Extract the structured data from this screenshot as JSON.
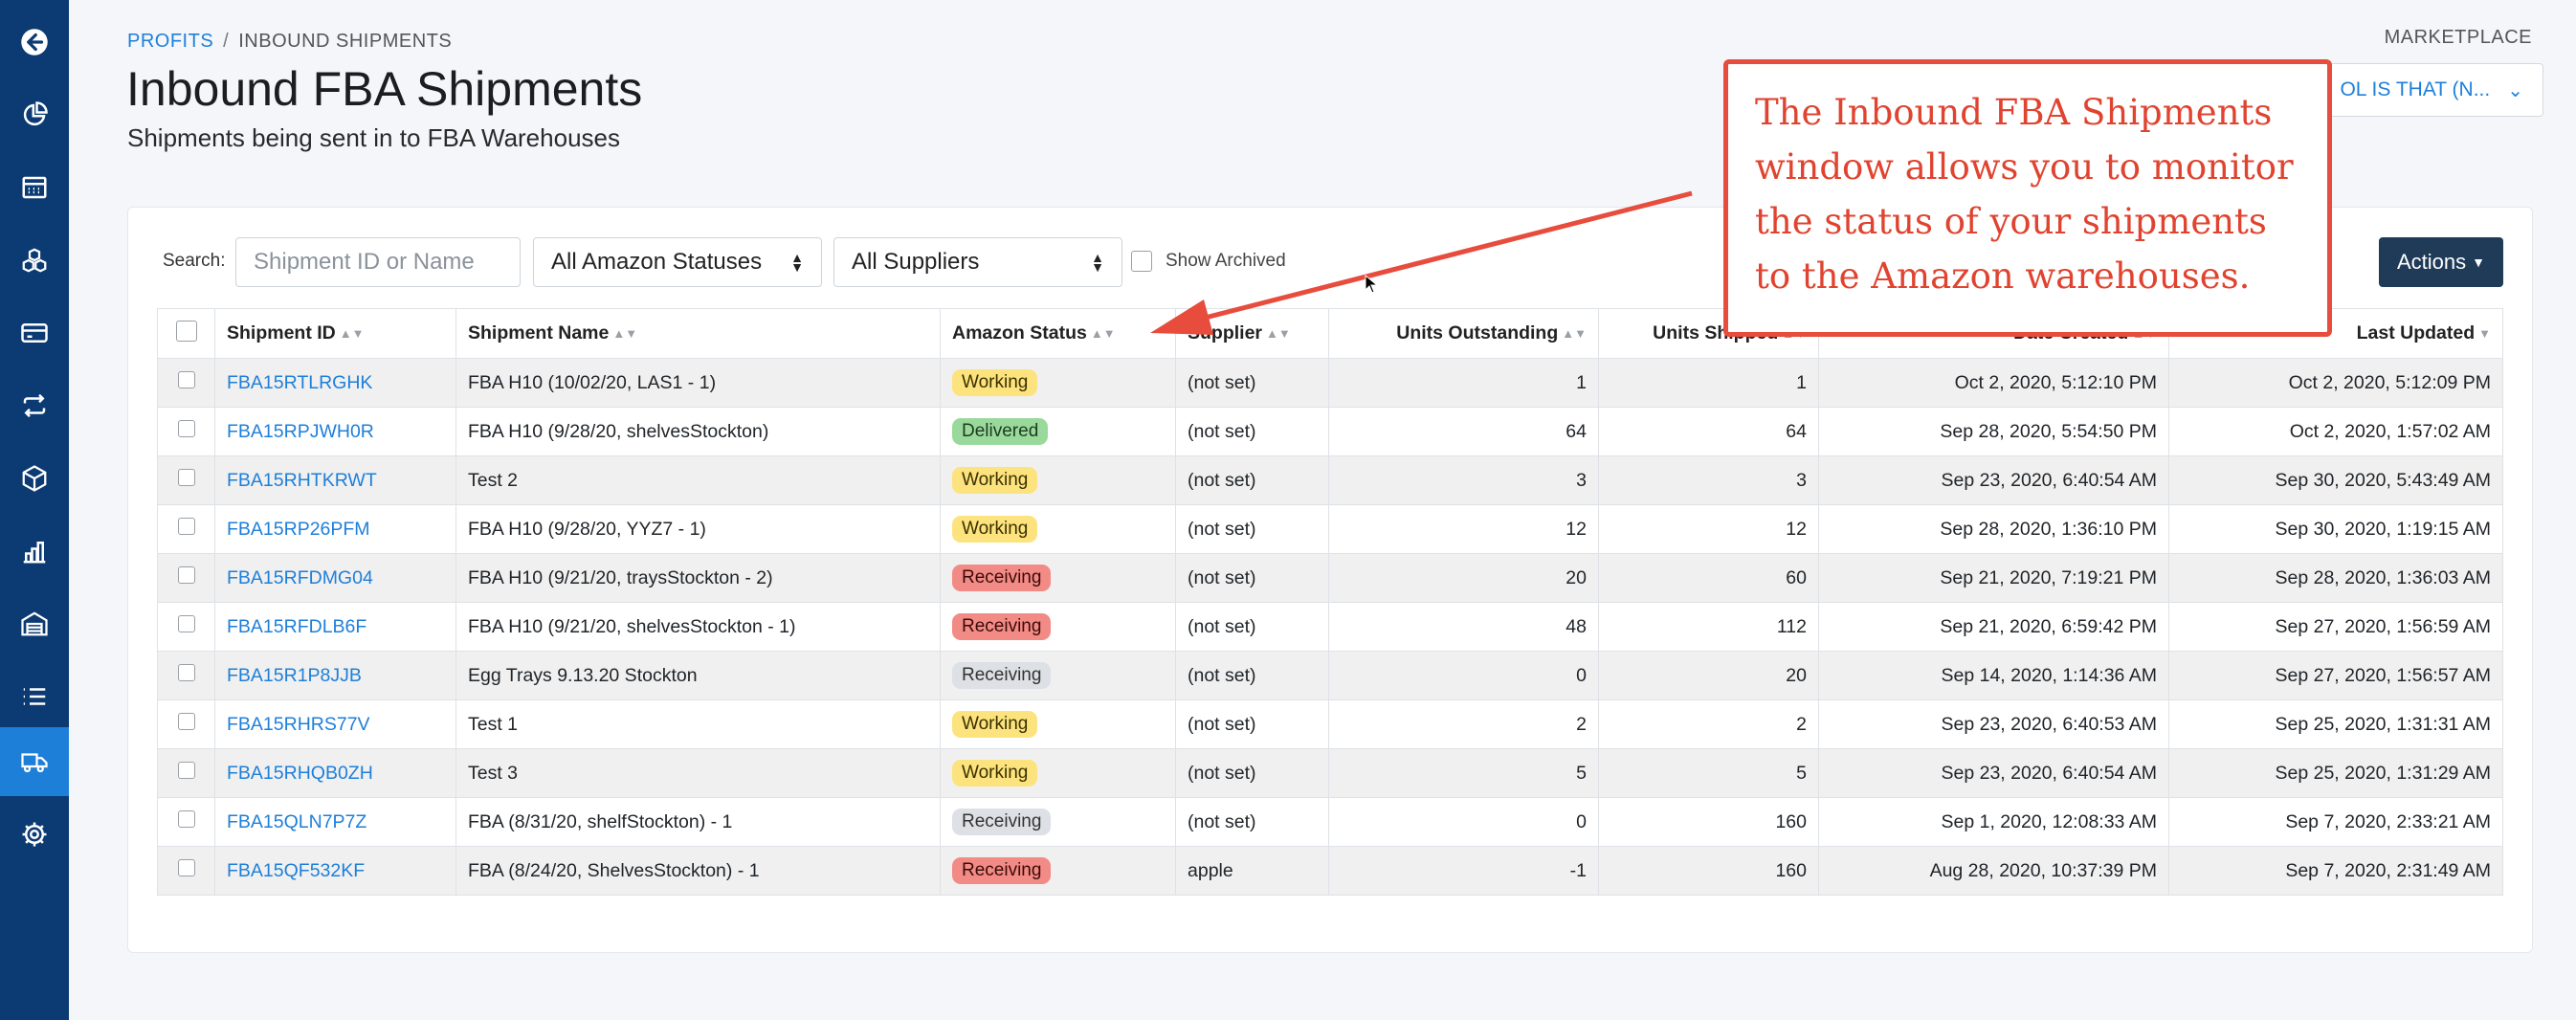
{
  "sidebar": {
    "items": [
      {
        "name": "back-icon"
      },
      {
        "name": "pie-chart-icon"
      },
      {
        "name": "calculator-icon"
      },
      {
        "name": "boxes-icon"
      },
      {
        "name": "credit-card-icon"
      },
      {
        "name": "repeat-icon"
      },
      {
        "name": "cube-icon"
      },
      {
        "name": "bar-chart-icon"
      },
      {
        "name": "warehouse-icon"
      },
      {
        "name": "list-icon"
      },
      {
        "name": "truck-icon"
      },
      {
        "name": "gear-icon"
      }
    ],
    "active": "truck-icon"
  },
  "breadcrumb": {
    "root": "PROFITS",
    "separator": "/",
    "current": "INBOUND SHIPMENTS"
  },
  "header": {
    "title": "Inbound FBA Shipments",
    "subtitle": "Shipments being sent in to FBA Warehouses",
    "marketplace_label": "MARKETPLACE",
    "marketplace_value": "OL IS THAT (N..."
  },
  "filters": {
    "search_label": "Search:",
    "search_placeholder": "Shipment ID or Name",
    "status_select": "All Amazon Statuses",
    "supplier_select": "All Suppliers",
    "archived_label": "Show Archived",
    "actions_label": "Actions"
  },
  "table": {
    "columns": [
      "Shipment ID",
      "Shipment Name",
      "Amazon Status",
      "Supplier",
      "Units Outstanding",
      "Units Shipped",
      "Date Created",
      "Last Updated"
    ],
    "rows": [
      {
        "id": "FBA15RTLRGHK",
        "name": "FBA H10 (10/02/20, LAS1 - 1)",
        "status": "Working",
        "supplier": "(not set)",
        "outstanding": "1",
        "shipped": "1",
        "created": "Oct 2, 2020, 5:12:10 PM",
        "updated": "Oct 2, 2020, 5:12:09 PM"
      },
      {
        "id": "FBA15RPJWH0R",
        "name": "FBA H10 (9/28/20, shelvesStockton)",
        "status": "Delivered",
        "supplier": "(not set)",
        "outstanding": "64",
        "shipped": "64",
        "created": "Sep 28, 2020, 5:54:50 PM",
        "updated": "Oct 2, 2020, 1:57:02 AM"
      },
      {
        "id": "FBA15RHTKRWT",
        "name": "Test 2",
        "status": "Working",
        "supplier": "(not set)",
        "outstanding": "3",
        "shipped": "3",
        "created": "Sep 23, 2020, 6:40:54 AM",
        "updated": "Sep 30, 2020, 5:43:49 AM"
      },
      {
        "id": "FBA15RP26PFM",
        "name": "FBA H10 (9/28/20, YYZ7 - 1)",
        "status": "Working",
        "supplier": "(not set)",
        "outstanding": "12",
        "shipped": "12",
        "created": "Sep 28, 2020, 1:36:10 PM",
        "updated": "Sep 30, 2020, 1:19:15 AM"
      },
      {
        "id": "FBA15RFDMG04",
        "name": "FBA H10 (9/21/20, traysStockton - 2)",
        "status": "Receiving",
        "supplier": "(not set)",
        "outstanding": "20",
        "shipped": "60",
        "created": "Sep 21, 2020, 7:19:21 PM",
        "updated": "Sep 28, 2020, 1:36:03 AM"
      },
      {
        "id": "FBA15RFDLB6F",
        "name": "FBA H10 (9/21/20, shelvesStockton - 1)",
        "status": "Receiving",
        "supplier": "(not set)",
        "outstanding": "48",
        "shipped": "112",
        "created": "Sep 21, 2020, 6:59:42 PM",
        "updated": "Sep 27, 2020, 1:56:59 AM"
      },
      {
        "id": "FBA15R1P8JJB",
        "name": "Egg Trays 9.13.20 Stockton",
        "status": "Receiving",
        "supplier": "(not set)",
        "outstanding": "0",
        "shipped": "20",
        "created": "Sep 14, 2020, 1:14:36 AM",
        "updated": "Sep 27, 2020, 1:56:57 AM"
      },
      {
        "id": "FBA15RHRS77V",
        "name": "Test 1",
        "status": "Working",
        "supplier": "(not set)",
        "outstanding": "2",
        "shipped": "2",
        "created": "Sep 23, 2020, 6:40:53 AM",
        "updated": "Sep 25, 2020, 1:31:31 AM"
      },
      {
        "id": "FBA15RHQB0ZH",
        "name": "Test 3",
        "status": "Working",
        "supplier": "(not set)",
        "outstanding": "5",
        "shipped": "5",
        "created": "Sep 23, 2020, 6:40:54 AM",
        "updated": "Sep 25, 2020, 1:31:29 AM"
      },
      {
        "id": "FBA15QLN7P7Z",
        "name": "FBA (8/31/20, shelfStockton) - 1",
        "status": "Receiving",
        "supplier": "(not set)",
        "outstanding": "0",
        "shipped": "160",
        "created": "Sep 1, 2020, 12:08:33 AM",
        "updated": "Sep 7, 2020, 2:33:21 AM"
      },
      {
        "id": "FBA15QF532KF",
        "name": "FBA (8/24/20, ShelvesStockton) - 1",
        "status": "Receiving",
        "supplier": "apple",
        "outstanding": "-1",
        "shipped": "160",
        "created": "Aug 28, 2020, 10:37:39 PM",
        "updated": "Sep 7, 2020, 2:31:49 AM"
      }
    ]
  },
  "callout": {
    "text": "The Inbound FBA Shipments window allows you to monitor the status of your shipments to the Amazon warehouses.",
    "color": "#e74c3c"
  },
  "colors": {
    "sidebar": "#0c3a73",
    "sidebar_active": "#1e7fd9",
    "link": "#1e7fd9",
    "actions_button": "#1f3b57"
  }
}
